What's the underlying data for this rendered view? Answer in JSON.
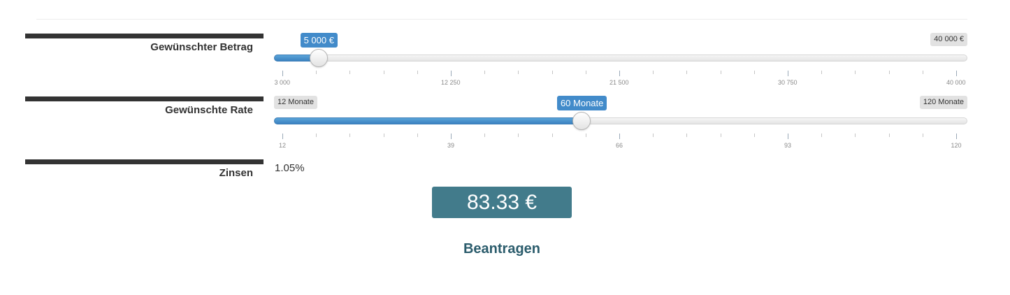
{
  "amount": {
    "label": "Gewünschter Betrag",
    "min_label": "5 000 €",
    "max_label": "40 000 €",
    "current_label": "5 000 €",
    "value": 5000,
    "range": [
      3000,
      40000
    ],
    "tick_labels": [
      "3 000",
      "12 250",
      "21 500",
      "30 750",
      "40 000"
    ]
  },
  "rate": {
    "label": "Gewünschte Rate",
    "min_label": "12 Monate",
    "max_label": "120 Monate",
    "current_label": "60 Monate",
    "value": 60,
    "range": [
      12,
      120
    ],
    "tick_labels": [
      "12",
      "39",
      "66",
      "93",
      "120"
    ]
  },
  "interest": {
    "label": "Zinsen",
    "value": "1.05%"
  },
  "result": {
    "value": "83.33 €"
  },
  "apply": {
    "label": "Beantragen"
  },
  "colors": {
    "accent": "#428bca",
    "result_bg": "#427b8b",
    "apply_text": "#2b5c6c"
  }
}
